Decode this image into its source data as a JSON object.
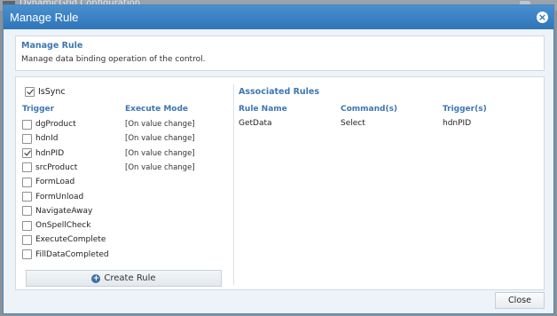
{
  "background": {
    "title": "DynamicGrid Configuration"
  },
  "dialog": {
    "title": "Manage Rule"
  },
  "header": {
    "title": "Manage Rule",
    "description": "Manage data binding operation of the control."
  },
  "issync": {
    "label": "IsSync",
    "checked": true
  },
  "columns": {
    "trigger": "Trigger",
    "execute_mode": "Execute Mode"
  },
  "triggers": [
    {
      "name": "dgProduct",
      "checked": false,
      "mode": "[On value change]"
    },
    {
      "name": "hdnId",
      "checked": false,
      "mode": "[On value change]"
    },
    {
      "name": "hdnPID",
      "checked": true,
      "mode": "[On value change]"
    },
    {
      "name": "srcProduct",
      "checked": false,
      "mode": "[On value change]"
    },
    {
      "name": "FormLoad",
      "checked": false,
      "mode": ""
    },
    {
      "name": "FormUnload",
      "checked": false,
      "mode": ""
    },
    {
      "name": "NavigateAway",
      "checked": false,
      "mode": ""
    },
    {
      "name": "OnSpellCheck",
      "checked": false,
      "mode": ""
    },
    {
      "name": "ExecuteComplete",
      "checked": false,
      "mode": ""
    },
    {
      "name": "FillDataCompleted",
      "checked": false,
      "mode": ""
    }
  ],
  "create_button": {
    "label": "Create Rule",
    "icon": "plus-circle-icon"
  },
  "associated": {
    "title": "Associated Rules",
    "headers": {
      "rule_name": "Rule Name",
      "commands": "Command(s)",
      "triggers": "Trigger(s)"
    },
    "rows": [
      {
        "rule_name": "GetData",
        "commands": "Select",
        "triggers": "hdnPID"
      }
    ]
  },
  "footer": {
    "close_label": "Close"
  },
  "colors": {
    "titlebar": "#2f75b8",
    "accent_text": "#3d76b4"
  }
}
